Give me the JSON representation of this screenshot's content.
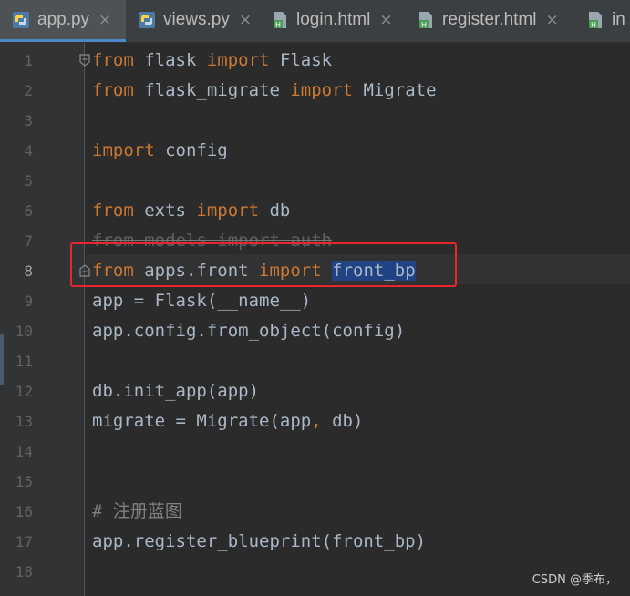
{
  "tabs": [
    {
      "label": "app.py",
      "icon": "python-file-icon",
      "active": true
    },
    {
      "label": "views.py",
      "icon": "python-file-icon",
      "active": false
    },
    {
      "label": "login.html",
      "icon": "html-file-icon",
      "active": false
    },
    {
      "label": "register.html",
      "icon": "html-file-icon",
      "active": false
    },
    {
      "label": "in",
      "icon": "html-file-icon",
      "active": false
    }
  ],
  "close_glyph": "×",
  "line_numbers": [
    "1",
    "2",
    "3",
    "4",
    "5",
    "6",
    "7",
    "8",
    "9",
    "10",
    "11",
    "12",
    "13",
    "14",
    "15",
    "16",
    "17",
    "18"
  ],
  "current_line": "8",
  "code": {
    "l1": {
      "kw1": "from",
      "mod": " flask ",
      "kw2": "import",
      "name": " Flask"
    },
    "l2": {
      "kw1": "from",
      "mod": " flask_migrate ",
      "kw2": "import",
      "name": " Migrate"
    },
    "l4": {
      "kw": "import",
      "name": " config"
    },
    "l6": {
      "kw1": "from",
      "mod": " exts ",
      "kw2": "import",
      "name": " db"
    },
    "l7": {
      "text": "from models import auth"
    },
    "l8": {
      "kw1": "from",
      "mod": " apps.front ",
      "kw2": "import",
      "space": " ",
      "selected": "front_bp"
    },
    "l9": {
      "text": "app = Flask(__name__)"
    },
    "l10": {
      "text": "app.config.from_object(config)"
    },
    "l12": {
      "text": "db.init_app(app)"
    },
    "l13": {
      "pre": "migrate = Migrate(app",
      "comma": ",",
      "post": " db)"
    },
    "l16": {
      "text": "# 注册蓝图"
    },
    "l17": {
      "text": "app.register_blueprint(front_bp)"
    }
  },
  "colors": {
    "keyword": "#cc7832",
    "text": "#a9b7c6",
    "comment": "#808080",
    "selection": "#214283",
    "annotation_box": "#e8262c",
    "active_tab_underline": "#4a88c7"
  },
  "watermark": "CSDN @季布，"
}
